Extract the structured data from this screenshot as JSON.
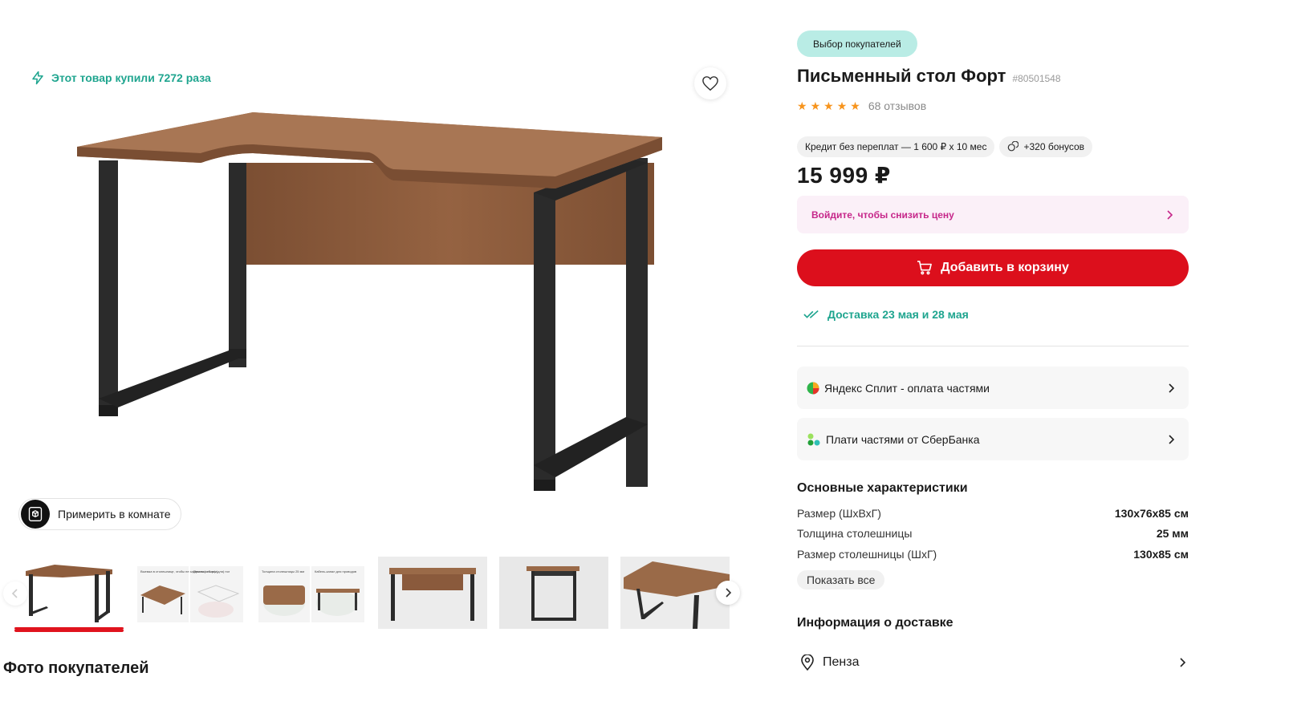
{
  "gallery": {
    "purchases_text": "Этот товар купили 7272 раза",
    "ar_button_label": "Примерить в комнате",
    "thumb_texts": {
      "t2a": "Выемка в столешнице, чтобы не задевать (что-то) (для) ног",
      "t2b": "Простая сборка",
      "t3a": "Толщина столешницы 25 мм",
      "t3b": "Кабель-канал для проводов"
    }
  },
  "product": {
    "badge": "Выбор покупателей",
    "title": "Письменный стол Форт",
    "sku": "#80501548",
    "rating": 5,
    "reviews": "68 отзывов",
    "credit": "Кредит без переплат — 1 600 ₽ x 10 мес",
    "bonus": "+320 бонусов",
    "price": "15 999 ₽",
    "login_text": "Войдите, чтобы снизить цену",
    "cart_button": "Добавить в корзину",
    "delivery": "Доставка 23 мая и 28 мая"
  },
  "payments": [
    {
      "label": "Яндекс Сплит - оплата частями"
    },
    {
      "label": "Плати частями от СберБанка"
    }
  ],
  "specs": {
    "title": "Основные характеристики",
    "rows": [
      {
        "k": "Размер (ШхВхГ)",
        "v": "130х76х85 см"
      },
      {
        "k": "Толщина столешницы",
        "v": "25 мм"
      },
      {
        "k": "Размер столешницы (ШхГ)",
        "v": "130х85 см"
      }
    ],
    "show_all": "Показать все"
  },
  "delivery_info": {
    "title": "Информация о доставке",
    "city": "Пенза"
  },
  "buyers_photo_title": "Фото покупателей",
  "colors": {
    "accent_red": "#dc0f1c",
    "teal": "#1fa58f",
    "pink": "#c6278a",
    "star": "#f7941d"
  }
}
